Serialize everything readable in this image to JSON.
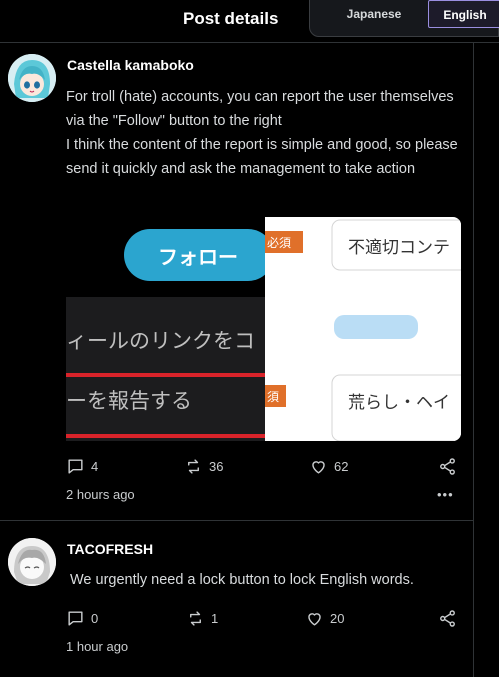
{
  "header": {
    "title": "Post details"
  },
  "language_switch": {
    "options": [
      "Japanese",
      "English"
    ],
    "selected": "English"
  },
  "posts": [
    {
      "author": "Castella kamaboko",
      "text": " For troll (hate) accounts, you can report the user themselves via the \"Follow\" button to the right\n I think the content of the report is simple and good, so please send it quickly and ask the management to take action",
      "attachment": {
        "follow_button": "フォロー",
        "menu_item_1": "ィールのリンクをコ",
        "menu_item_2": "ーを報告する",
        "required_badge_1": "必須",
        "required_badge_2": "須",
        "field_1": "不適切コンテ",
        "field_2": "荒らし・ヘイ"
      },
      "replies": "4",
      "reposts": "36",
      "likes": "62",
      "time": "2 hours ago",
      "more": "•••"
    },
    {
      "author": "TACOFRESH",
      "text": "We urgently need a lock button to lock English words.",
      "replies": "0",
      "reposts": "1",
      "likes": "20",
      "time": "1 hour ago",
      "more": "•••"
    }
  ],
  "colors": {
    "accent": "#9a8ee0",
    "follow_button": "#2ba5cf",
    "report_underline": "#d9232a",
    "required_badge": "#e0702a"
  }
}
